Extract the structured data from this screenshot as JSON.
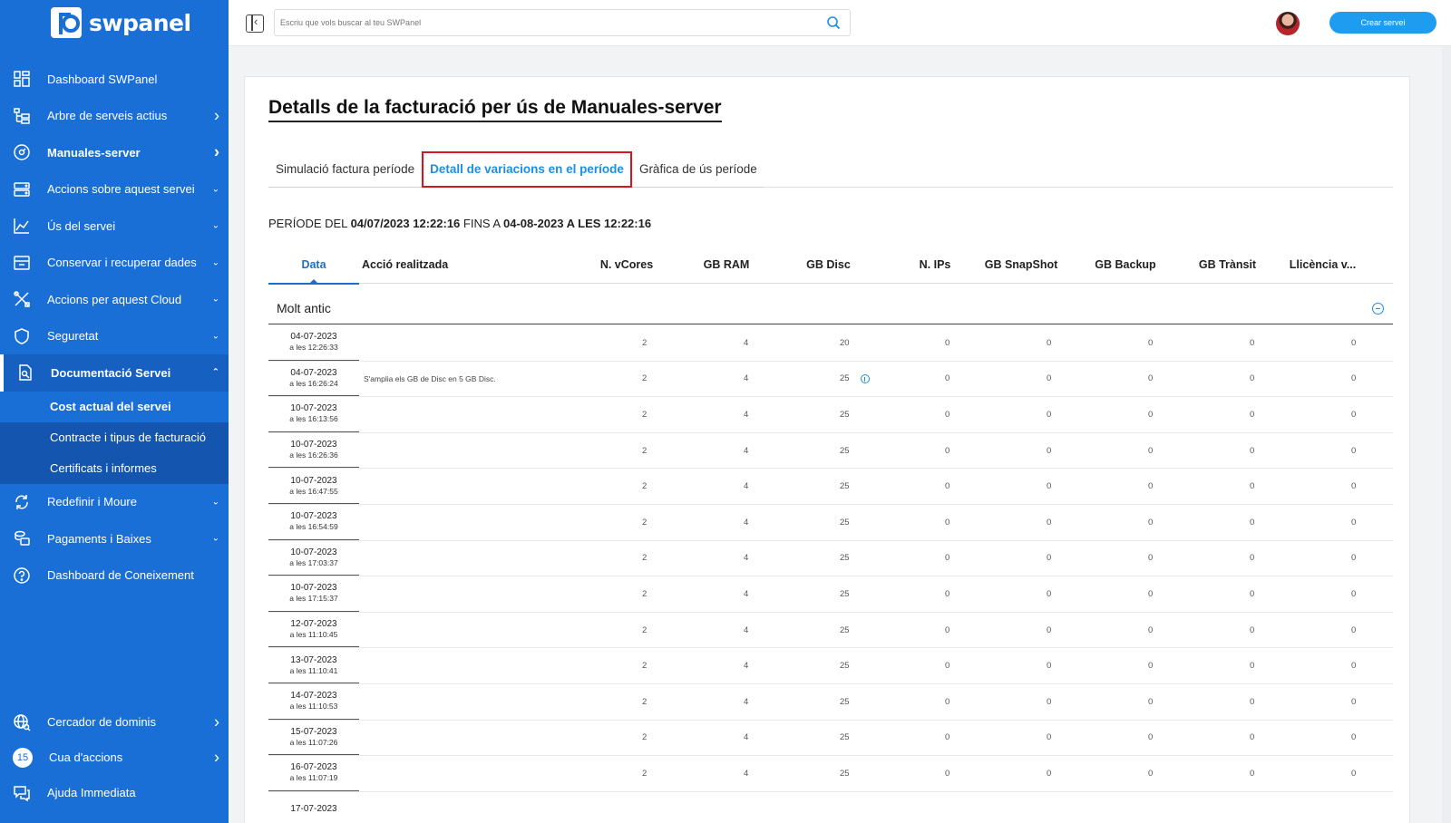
{
  "brand": {
    "name": "swpanel"
  },
  "sidebar": {
    "items": [
      {
        "label": "Dashboard SWPanel",
        "icon": "dashboard-icon"
      },
      {
        "label": "Arbre de serveis actius",
        "icon": "tree-icon",
        "chevron": "›"
      },
      {
        "label": "Manuales-server",
        "icon": "server-icon",
        "chevron": "›",
        "bold": true
      },
      {
        "label": "Accions sobre aquest servei",
        "icon": "actions-icon",
        "chevron": "⌄"
      },
      {
        "label": "Ús del servei",
        "icon": "usage-chart-icon",
        "chevron": "⌄"
      },
      {
        "label": "Conservar i recuperar dades",
        "icon": "archive-icon",
        "chevron": "⌄"
      },
      {
        "label": "Accions per aquest Cloud",
        "icon": "tools-icon",
        "chevron": "⌄"
      },
      {
        "label": "Seguretat",
        "icon": "shield-icon",
        "chevron": "⌄"
      },
      {
        "label": "Documentació Servei",
        "icon": "documentation-icon",
        "chevron": "⌃",
        "active": true
      }
    ],
    "submenu": [
      {
        "label": "Cost actual del servei",
        "current": true
      },
      {
        "label": "Contracte i tipus de facturació"
      },
      {
        "label": "Certificats i informes"
      }
    ],
    "items_after": [
      {
        "label": "Redefinir i Moure",
        "icon": "redefine-icon",
        "chevron": "⌄"
      },
      {
        "label": "Pagaments i Baixes",
        "icon": "payments-icon",
        "chevron": "⌄"
      },
      {
        "label": "Dashboard de Coneixement",
        "icon": "help-circle-icon"
      }
    ],
    "bottom": [
      {
        "label": "Cercador de dominis",
        "icon": "globe-search-icon",
        "chevron": "›"
      },
      {
        "label": "Cua d'accions",
        "badge": "15",
        "chevron": "›"
      },
      {
        "label": "Ajuda Immediata",
        "icon": "chat-help-icon"
      }
    ]
  },
  "topbar": {
    "search_placeholder": "Escriu que vols buscar al teu SWPanel",
    "create_label": "Crear servei"
  },
  "page": {
    "title": "Detalls de la facturació per ús de Manuales-server",
    "tabs": [
      {
        "label": "Simulació factura període"
      },
      {
        "label": "Detall de variacions en el període",
        "active": true
      },
      {
        "label": "Gràfica de ús període"
      }
    ],
    "period": {
      "prefix": "PERÍODE DEL",
      "start": "04/07/2023 12:22:16",
      "mid": "FINS A",
      "end": "04-08-2023 A LES 12:22:16"
    },
    "columns": [
      "Data",
      "Acció realitzada",
      "N. vCores",
      "GB RAM",
      "GB Disc",
      "N. IPs",
      "GB SnapShot",
      "GB Backup",
      "GB Trànsit",
      "Llicència v..."
    ],
    "group_label": "Molt antic",
    "rows": [
      {
        "date": "04-07-2023",
        "time": "a les 12:26:33",
        "action": "",
        "vcores": "2",
        "ram": "4",
        "disc": "20",
        "ips": "0",
        "snapshot": "0",
        "backup": "0",
        "transit": "0",
        "licence": "0"
      },
      {
        "date": "04-07-2023",
        "time": "a les 16:26:24",
        "action": "S'amplia els GB de Disc en 5 GB Disc.",
        "vcores": "2",
        "ram": "4",
        "disc": "25",
        "info": true,
        "ips": "0",
        "snapshot": "0",
        "backup": "0",
        "transit": "0",
        "licence": "0"
      },
      {
        "date": "10-07-2023",
        "time": "a les 16:13:56",
        "action": "",
        "vcores": "2",
        "ram": "4",
        "disc": "25",
        "ips": "0",
        "snapshot": "0",
        "backup": "0",
        "transit": "0",
        "licence": "0"
      },
      {
        "date": "10-07-2023",
        "time": "a les 16:26:36",
        "action": "",
        "vcores": "2",
        "ram": "4",
        "disc": "25",
        "ips": "0",
        "snapshot": "0",
        "backup": "0",
        "transit": "0",
        "licence": "0"
      },
      {
        "date": "10-07-2023",
        "time": "a les 16:47:55",
        "action": "",
        "vcores": "2",
        "ram": "4",
        "disc": "25",
        "ips": "0",
        "snapshot": "0",
        "backup": "0",
        "transit": "0",
        "licence": "0"
      },
      {
        "date": "10-07-2023",
        "time": "a les 16:54:59",
        "action": "",
        "vcores": "2",
        "ram": "4",
        "disc": "25",
        "ips": "0",
        "snapshot": "0",
        "backup": "0",
        "transit": "0",
        "licence": "0"
      },
      {
        "date": "10-07-2023",
        "time": "a les 17:03:37",
        "action": "",
        "vcores": "2",
        "ram": "4",
        "disc": "25",
        "ips": "0",
        "snapshot": "0",
        "backup": "0",
        "transit": "0",
        "licence": "0"
      },
      {
        "date": "10-07-2023",
        "time": "a les 17:15:37",
        "action": "",
        "vcores": "2",
        "ram": "4",
        "disc": "25",
        "ips": "0",
        "snapshot": "0",
        "backup": "0",
        "transit": "0",
        "licence": "0"
      },
      {
        "date": "12-07-2023",
        "time": "a les 11:10:45",
        "action": "",
        "vcores": "2",
        "ram": "4",
        "disc": "25",
        "ips": "0",
        "snapshot": "0",
        "backup": "0",
        "transit": "0",
        "licence": "0"
      },
      {
        "date": "13-07-2023",
        "time": "a les 11:10:41",
        "action": "",
        "vcores": "2",
        "ram": "4",
        "disc": "25",
        "ips": "0",
        "snapshot": "0",
        "backup": "0",
        "transit": "0",
        "licence": "0"
      },
      {
        "date": "14-07-2023",
        "time": "a les 11:10:53",
        "action": "",
        "vcores": "2",
        "ram": "4",
        "disc": "25",
        "ips": "0",
        "snapshot": "0",
        "backup": "0",
        "transit": "0",
        "licence": "0"
      },
      {
        "date": "15-07-2023",
        "time": "a les 11:07:26",
        "action": "",
        "vcores": "2",
        "ram": "4",
        "disc": "25",
        "ips": "0",
        "snapshot": "0",
        "backup": "0",
        "transit": "0",
        "licence": "0"
      },
      {
        "date": "16-07-2023",
        "time": "a les 11:07:19",
        "action": "",
        "vcores": "2",
        "ram": "4",
        "disc": "25",
        "ips": "0",
        "snapshot": "0",
        "backup": "0",
        "transit": "0",
        "licence": "0"
      },
      {
        "date": "17-07-2023",
        "time": "",
        "action": "",
        "vcores": "",
        "ram": "",
        "disc": "",
        "ips": "",
        "snapshot": "",
        "backup": "",
        "transit": "",
        "licence": ""
      }
    ]
  },
  "colors": {
    "sidebar": "#1a6fd6",
    "accent": "#1e8fe0",
    "highlight": "#d7141f"
  }
}
